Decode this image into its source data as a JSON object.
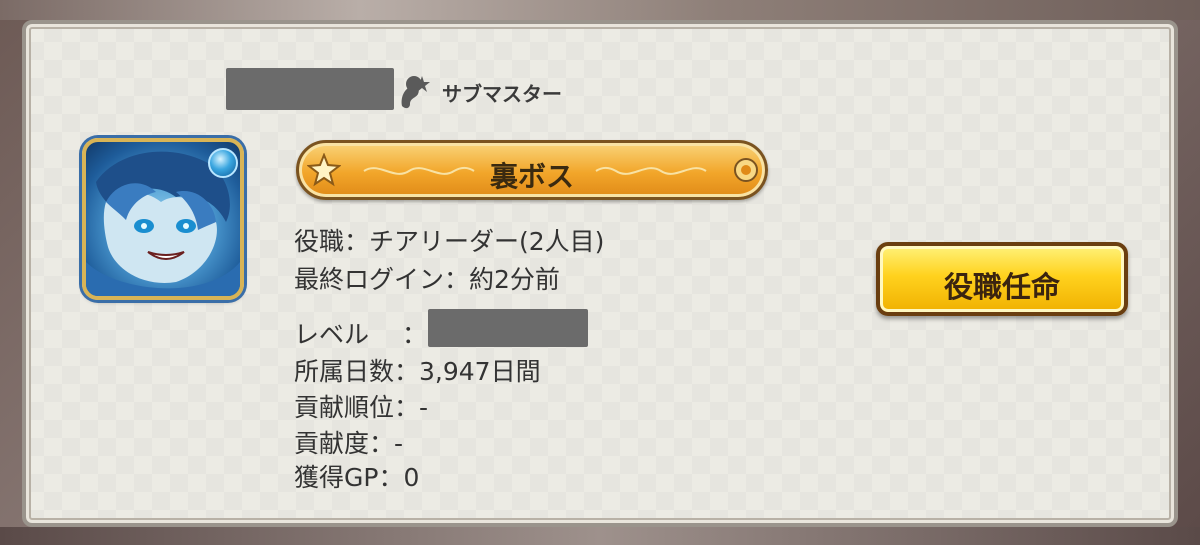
{
  "member": {
    "role_label": "サブマスター",
    "title": "裏ボス",
    "position_line": "役職：チアリーダー(2人目)",
    "last_login_line": "最終ログイン：約2分前",
    "level_label": "レベル　 ：",
    "days_line": "所属日数：3,947日間",
    "contrib_rank_line": "貢献順位：-",
    "contrib_line": "貢献度：-",
    "gp_line": "獲得GP：0"
  },
  "actions": {
    "appoint_label": "役職任命"
  },
  "icons": {
    "role": "sub-master-icon",
    "title_star": "star-icon",
    "attribute": "water-orb-icon"
  },
  "colors": {
    "title_bar": "#f2a62a",
    "button": "#ffd21e",
    "panel": "#ecebe4"
  }
}
